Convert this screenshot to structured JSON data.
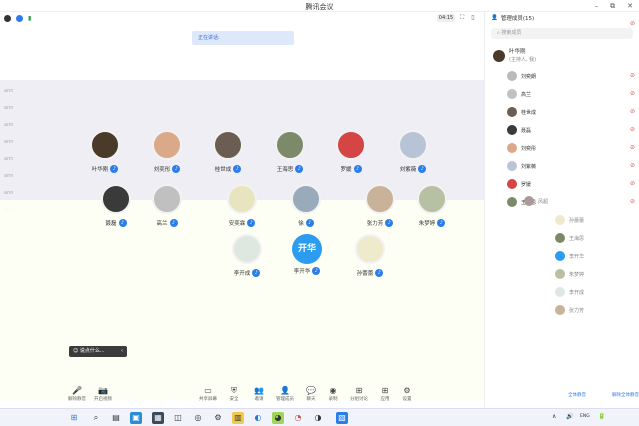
{
  "window": {
    "title": "腾讯会议",
    "controls": [
      "–",
      "⧉",
      "✕"
    ]
  },
  "top": {
    "timer": "04:15",
    "speaking_label": "正在讲话:"
  },
  "panel": {
    "header": "管理成员(15)",
    "search_placeholder": "搜索成员",
    "host": {
      "name": "叶华刚",
      "role": "(主持人, 我)"
    },
    "members": [
      "刘奕朗",
      "高兰",
      "桂世成",
      "聂磊",
      "刘奕彤",
      "刘紫薇",
      "罗媛",
      "王海思"
    ]
  },
  "left_pad": [
    "ann",
    "ann",
    "ann",
    "ann",
    "ann",
    "ann",
    "ann",
    "ann"
  ],
  "grid_row1": [
    {
      "name": "叶华刚",
      "color": "#4a3a2a"
    },
    {
      "name": "刘奕彤",
      "color": "#d9a98a"
    },
    {
      "name": "桂世成",
      "color": "#6b5d52"
    },
    {
      "name": "王海思",
      "color": "#7c8a6a"
    },
    {
      "name": "罗媛",
      "color": "#d64545"
    },
    {
      "name": "刘紫薇",
      "color": "#b8c4d6"
    }
  ],
  "grid_row2": [
    {
      "name": "聂磊",
      "color": "#3a3a3a"
    },
    {
      "name": "高兰",
      "color": "#c0c0c0"
    },
    {
      "name": "安奕霖",
      "color": "#e8e4c0"
    },
    {
      "name": "徐",
      "color": "#9ab"
    },
    {
      "name": "张力芳",
      "color": "#c9b29a"
    },
    {
      "name": "朱梦婷",
      "color": "#b8c0a4"
    }
  ],
  "grid_row3": [
    {
      "name": "李开成",
      "color": "#dfe8e0",
      "text": ""
    },
    {
      "name": "李开华",
      "color": "#2b9cf0",
      "text": "开华"
    },
    {
      "name": "孙蕾蕾",
      "color": "#eeeacc",
      "text": ""
    }
  ],
  "right_list": [
    "孙蕾蕾",
    "王海思",
    "李开华",
    "朱梦婷",
    "李开成",
    "张力芳"
  ],
  "right_list_top": "风超",
  "chat": {
    "label": "说点什么...",
    "arrow": "‹"
  },
  "bottom_left": [
    {
      "label": "解除静音",
      "glyph": "🎤"
    },
    {
      "label": "开启视频",
      "glyph": "📷"
    }
  ],
  "bottom_tools": [
    {
      "label": "共享屏幕",
      "glyph": "▭"
    },
    {
      "label": "安全",
      "glyph": "⛨"
    },
    {
      "label": "邀请",
      "glyph": "👥"
    },
    {
      "label": "管理成员",
      "glyph": "👤"
    },
    {
      "label": "聊天",
      "glyph": "💬"
    },
    {
      "label": "录制",
      "glyph": "◉"
    },
    {
      "label": "分组讨论",
      "glyph": "⊞"
    },
    {
      "label": "应用",
      "glyph": "⊞"
    },
    {
      "label": "设置",
      "glyph": "⚙"
    }
  ],
  "bottom_right": [
    "全体静音",
    "解除全体静音"
  ],
  "bottom_far_left": [
    "ann",
    "更多"
  ],
  "taskbar_icons": [
    "⊞",
    "⌕",
    "▤",
    "▣",
    "▦",
    "◫",
    "◎",
    "⚙",
    "▥",
    "◐",
    "◕",
    "◔",
    "◑",
    "◒",
    "▧"
  ],
  "tray": [
    "∧",
    "🔊",
    "ENG",
    "🔋"
  ]
}
